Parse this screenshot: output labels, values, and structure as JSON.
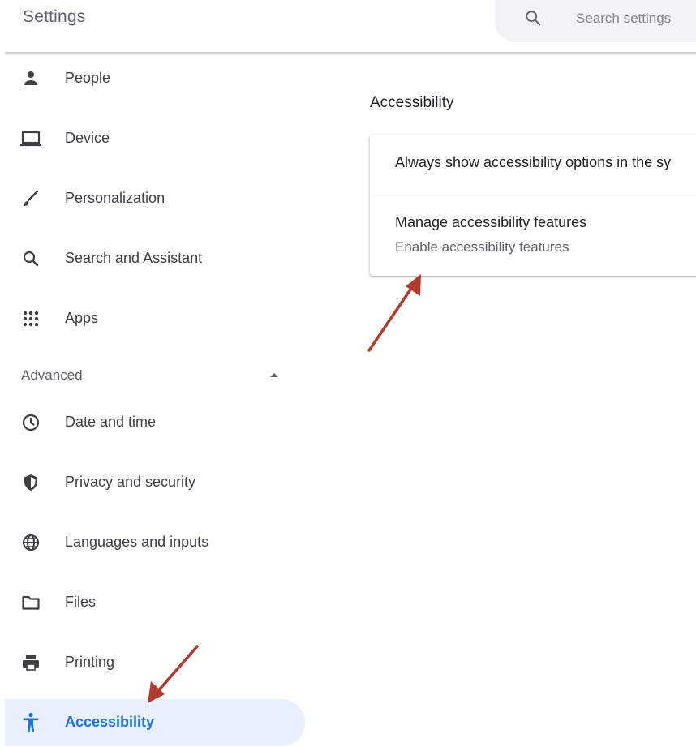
{
  "header": {
    "title": "Settings",
    "search": {
      "placeholder": "Search settings"
    }
  },
  "sidebar": {
    "items": [
      {
        "label": "People",
        "icon": "person-icon"
      },
      {
        "label": "Device",
        "icon": "laptop-icon"
      },
      {
        "label": "Personalization",
        "icon": "brush-icon"
      },
      {
        "label": "Search and Assistant",
        "icon": "search-icon"
      },
      {
        "label": "Apps",
        "icon": "apps-grid-icon"
      }
    ],
    "advanced": {
      "label": "Advanced",
      "expanded": true,
      "items": [
        {
          "label": "Date and time",
          "icon": "clock-icon"
        },
        {
          "label": "Privacy and security",
          "icon": "shield-icon"
        },
        {
          "label": "Languages and inputs",
          "icon": "globe-icon"
        },
        {
          "label": "Files",
          "icon": "folder-icon"
        },
        {
          "label": "Printing",
          "icon": "printer-icon"
        },
        {
          "label": "Accessibility",
          "icon": "accessibility-icon",
          "selected": true
        }
      ]
    }
  },
  "main": {
    "title": "Accessibility",
    "rows": [
      {
        "title": "Always show accessibility options in the sy"
      },
      {
        "title": "Manage accessibility features",
        "subtitle": "Enable accessibility features"
      }
    ]
  },
  "colors": {
    "accent": "#1a73e8",
    "selected_bg": "#e8f0fe",
    "annotation_arrow": "#b03a2e",
    "icon": "#3c4043"
  }
}
